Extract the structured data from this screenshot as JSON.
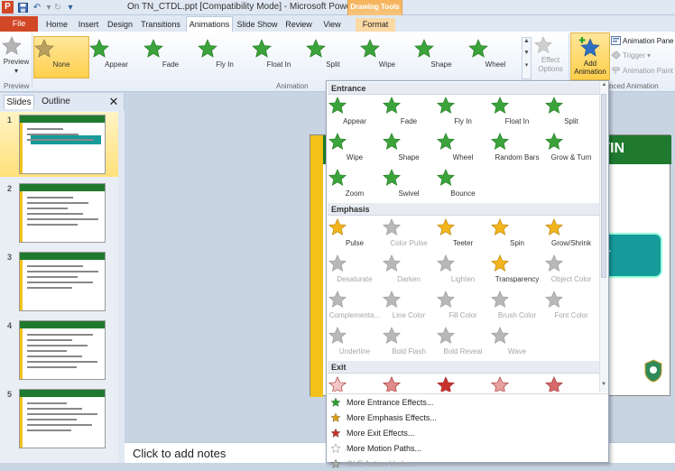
{
  "window": {
    "title": "On TN_CTDL.ppt [Compatibility Mode] - Microsoft PowerPoint",
    "app_icon_letter": "P",
    "context_group": "Drawing Tools"
  },
  "tabs": [
    {
      "label": "File"
    },
    {
      "label": "Home"
    },
    {
      "label": "Insert"
    },
    {
      "label": "Design"
    },
    {
      "label": "Transitions"
    },
    {
      "label": "Animations"
    },
    {
      "label": "Slide Show"
    },
    {
      "label": "Review"
    },
    {
      "label": "View"
    },
    {
      "label": "Format"
    }
  ],
  "ribbon": {
    "preview_label": "Preview",
    "preview_group": "Preview",
    "animation_group": "Animation",
    "advanced_group": "nced Animation",
    "gallery": [
      {
        "label": "None",
        "selected": true
      },
      {
        "label": "Appear"
      },
      {
        "label": "Fade"
      },
      {
        "label": "Fly In"
      },
      {
        "label": "Float In"
      },
      {
        "label": "Split"
      },
      {
        "label": "Wipe"
      },
      {
        "label": "Shape"
      },
      {
        "label": "Wheel"
      }
    ],
    "effect_options": "Effect Options",
    "add_animation_line1": "Add",
    "add_animation_line2": "Animation",
    "animation_pane": "Animation Pane",
    "trigger": "Trigger",
    "animation_painter": "Animation Paint"
  },
  "slides_pane": {
    "tab_slides": "Slides",
    "tab_outline": "Outline",
    "slide_numbers": [
      "1",
      "2",
      "3",
      "4",
      "5"
    ],
    "selected": "1"
  },
  "slide": {
    "header_text": "TIN",
    "button_text": "T"
  },
  "notes_placeholder": "Click to add notes",
  "dropdown": {
    "entrance_title": "Entrance",
    "entrance": [
      {
        "label": "Appear",
        "enabled": true
      },
      {
        "label": "Fade",
        "enabled": true
      },
      {
        "label": "Fly In",
        "enabled": true
      },
      {
        "label": "Float In",
        "enabled": true
      },
      {
        "label": "Split",
        "enabled": true
      },
      {
        "label": "Wipe",
        "enabled": true
      },
      {
        "label": "Shape",
        "enabled": true
      },
      {
        "label": "Wheel",
        "enabled": true
      },
      {
        "label": "Random Bars",
        "enabled": true
      },
      {
        "label": "Grow & Turn",
        "enabled": true
      },
      {
        "label": "Zoom",
        "enabled": true
      },
      {
        "label": "Swivel",
        "enabled": true
      },
      {
        "label": "Bounce",
        "enabled": true
      }
    ],
    "emphasis_title": "Emphasis",
    "emphasis": [
      {
        "label": "Pulse",
        "enabled": true
      },
      {
        "label": "Color Pulse",
        "enabled": false
      },
      {
        "label": "Teeter",
        "enabled": true
      },
      {
        "label": "Spin",
        "enabled": true
      },
      {
        "label": "Grow/Shrink",
        "enabled": true
      },
      {
        "label": "Desaturate",
        "enabled": false
      },
      {
        "label": "Darken",
        "enabled": false
      },
      {
        "label": "Lighten",
        "enabled": false
      },
      {
        "label": "Transparency",
        "enabled": true
      },
      {
        "label": "Object Color",
        "enabled": false
      },
      {
        "label": "Complementa...",
        "enabled": false
      },
      {
        "label": "Line Color",
        "enabled": false
      },
      {
        "label": "Fill Color",
        "enabled": false
      },
      {
        "label": "Brush Color",
        "enabled": false
      },
      {
        "label": "Font Color",
        "enabled": false
      },
      {
        "label": "Underline",
        "enabled": false
      },
      {
        "label": "Bold Flash",
        "enabled": false
      },
      {
        "label": "Bold Reveal",
        "enabled": false
      },
      {
        "label": "Wave",
        "enabled": false
      }
    ],
    "exit_title": "Exit",
    "more": [
      {
        "label": "More Entrance Effects...",
        "enabled": true
      },
      {
        "label": "More Emphasis Effects...",
        "enabled": true
      },
      {
        "label": "More Exit Effects...",
        "enabled": true
      },
      {
        "label": "More Motion Paths...",
        "enabled": true
      },
      {
        "label": "OLE Action Verbs...",
        "enabled": false
      }
    ]
  },
  "colors": {
    "file_tab": "#d24726",
    "entrance_green": "#3aa33a",
    "emphasis_gold": "#f2b51c",
    "exit_red": "#c8322e",
    "disabled_gray": "#b8b8b8",
    "slide_green": "#1f7a2f",
    "slide_teal": "#169a9a",
    "selection_gold": "#ffd04e"
  }
}
